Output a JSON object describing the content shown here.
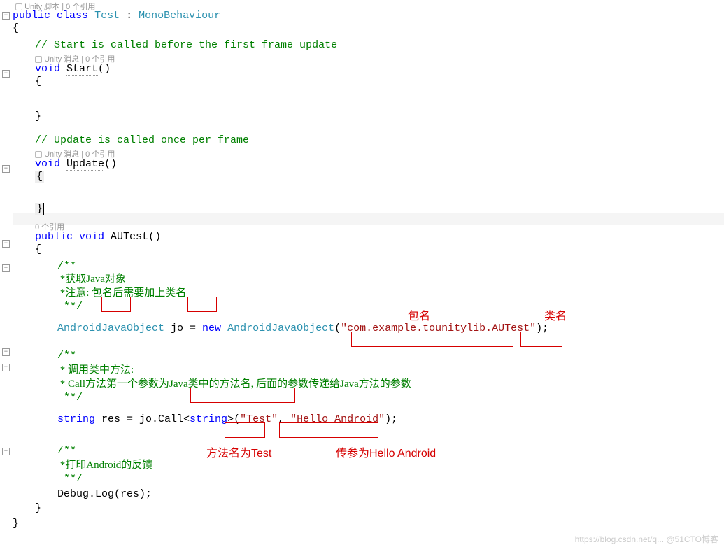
{
  "tops": {
    "codelens_script": "Unity 脚本 | 0 个引用",
    "class_decl_1": "public",
    "class_decl_2": "class",
    "class_name": "Test",
    "class_colon": ":",
    "class_base": "MonoBehaviour"
  },
  "start": {
    "comment": "// Start is called before the first frame update",
    "codelens": "Unity 消息 | 0 个引用",
    "kw": "void",
    "name": "Start"
  },
  "update": {
    "comment": "// Update is called once per frame",
    "codelens": "Unity 消息 | 0 个引用",
    "kw": "void",
    "name": "Update"
  },
  "autest": {
    "codelens": "0 个引用",
    "mods": "public void",
    "name": "AUTest"
  },
  "blk1": {
    "l1": "/**",
    "l2a": " *获取Java对象",
    "l3a": " *注意: ",
    "l3b": "包名",
    "l3c": "后需要加上",
    "l3d": "类名",
    "l4": " **/",
    "code_prefix": "AndroidJavaObject",
    "code_var": " jo = ",
    "code_new": "new",
    "code_type2": " AndroidJavaObject",
    "code_open": "(",
    "code_str": "\"com.example.tounitylib.AUTest\"",
    "code_close": ");"
  },
  "blk2": {
    "l1": "/**",
    "l2": " * 调用类中方法:",
    "l3a": " * Call方法第一个参数为",
    "l3b": "Java类中的方法名",
    "l3c": ", 后面的参数传递给Java方法的参数",
    "l4": " **/",
    "code_kw": "string",
    "code_mid": " res = jo.Call<",
    "code_gen": "string",
    "code_mid2": ">(",
    "code_s1": "\"Test\"",
    "code_comma": ", ",
    "code_s2": "\"Hello Android\"",
    "code_close": ");"
  },
  "blk3": {
    "l1": "/**",
    "l2": " *打印Android的反馈",
    "l3": " **/",
    "code": "Debug.Log(res);"
  },
  "ann": {
    "pkg": "包名",
    "cls": "类名",
    "method": "方法名为Test",
    "param": "传参为Hello Android"
  },
  "watermark": "https://blog.csdn.net/q... @51CTO博客"
}
